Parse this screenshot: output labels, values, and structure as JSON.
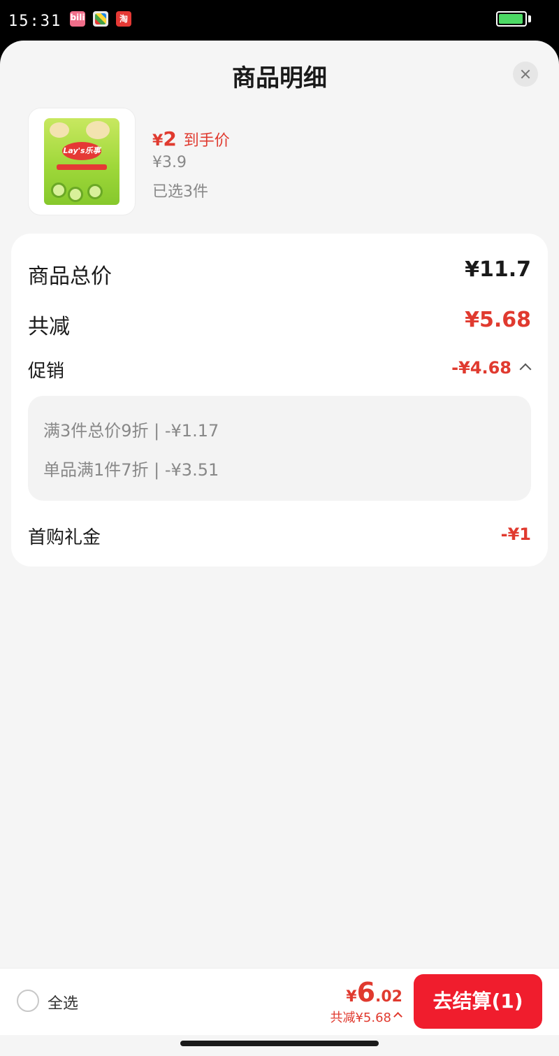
{
  "status_bar": {
    "time": "15:31",
    "app_icons": [
      "bilibili-icon",
      "game-icon",
      "taobao-icon"
    ],
    "battery_level": 0.95
  },
  "sheet": {
    "title": "商品明细"
  },
  "product": {
    "deal_price_symbol": "¥",
    "deal_price": "2",
    "deal_price_tag": "到手价",
    "original_price": "¥3.9",
    "selected_count": "已选3件",
    "image_brand": "Lay's乐事"
  },
  "summary": {
    "total_label": "商品总价",
    "total_value": "¥11.7",
    "reduce_label": "共减",
    "reduce_value": "¥5.68",
    "promo_label": "促销",
    "promo_value": "-¥4.68",
    "promo_items": [
      "满3件总价9折 | -¥1.17",
      "单品满1件7折 | -¥3.51"
    ],
    "gift_label": "首购礼金",
    "gift_value": "-¥1"
  },
  "bottom_bar": {
    "select_all_label": "全选",
    "sum_symbol": "¥",
    "sum_int": "6",
    "sum_dec": ".02",
    "sum_reduce": "共减¥5.68",
    "checkout_label": "去结算(1)"
  },
  "colors": {
    "accent_red": "#e03a2f",
    "button_red": "#f01d2d",
    "background": "#f5f5f5"
  }
}
